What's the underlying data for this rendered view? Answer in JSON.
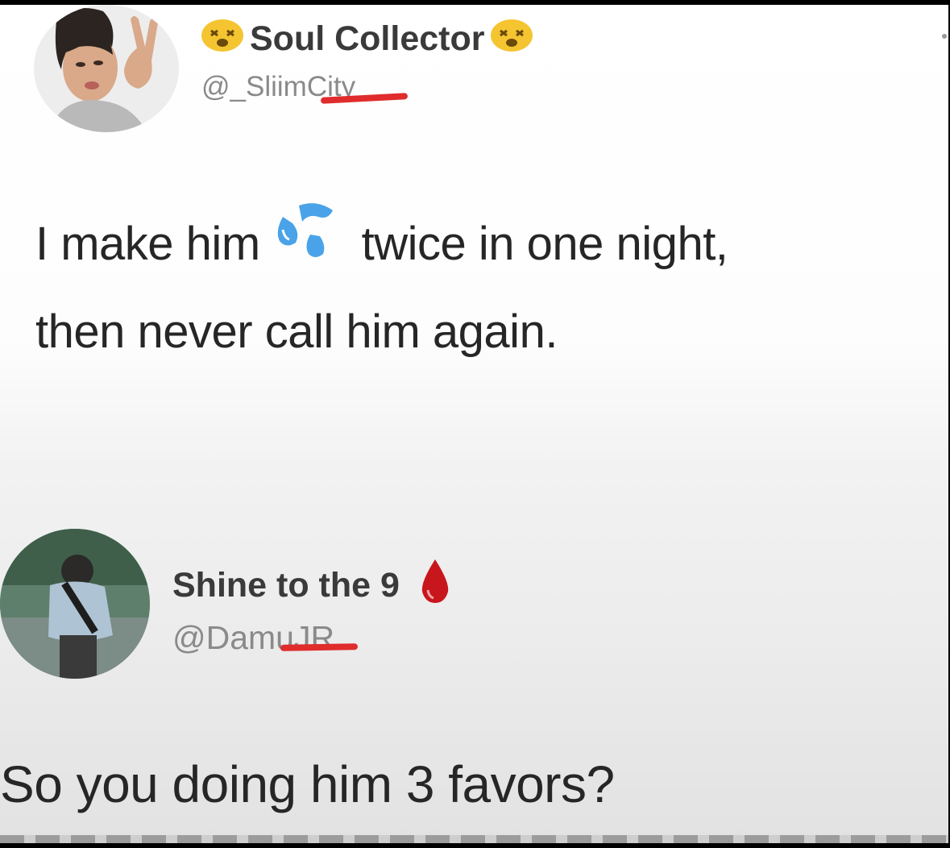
{
  "tweet": {
    "display_name": "Soul Collector",
    "handle": "@_SliimCity",
    "name_emoji": "dizzy-face-emoji",
    "text_before_emoji": "I make him",
    "text_emoji": "sweat-droplets-emoji",
    "text_after_emoji": "twice in one night,",
    "text_line2": "then never call him again."
  },
  "reply": {
    "display_name": "Shine to the 9",
    "handle": "@DamuJR",
    "name_emoji": "drop-of-blood-emoji",
    "text": "So you doing him 3 favors?"
  },
  "colors": {
    "redaction": "#e02c2c",
    "text": "#262626",
    "handle": "#8a8a8a",
    "sweat_drop": "#4aa3e8",
    "blood_drop": "#c8161d"
  }
}
